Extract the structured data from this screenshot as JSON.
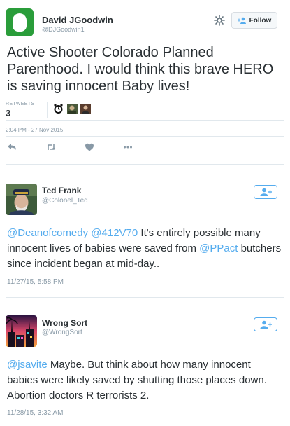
{
  "main_tweet": {
    "name": "David JGoodwin",
    "handle": "@DJGoodwin1",
    "follow_label": "Follow",
    "text": "Active Shooter Colorado Planned Parenthood.  I would think this brave HERO is saving innocent Baby lives!",
    "retweets_label": "RETWEETS",
    "retweets_count": "3",
    "timestamp": "2:04 PM - 27 Nov 2015"
  },
  "replies": [
    {
      "name": "Ted Frank",
      "handle": "@Colonel_Ted",
      "mentions": [
        "@Deanofcomedy",
        "@412V70",
        "@PPact"
      ],
      "text_a": "It's entirely possible many innocent lives of babies were saved from",
      "text_b": "butchers since incident began at mid-day..",
      "timestamp": "11/27/15, 5:58 PM"
    },
    {
      "name": "Wrong Sort",
      "handle": "@WrongSort",
      "mentions": [
        "@jsavite"
      ],
      "text_a": "Maybe.  But think about how many innocent babies were likely saved by shutting those places down.  Abortion doctors R terrorists 2.",
      "timestamp": "11/28/15, 3:32 AM"
    }
  ],
  "colors": {
    "link": "#55acee",
    "text": "#292f33",
    "muted": "#8899a6",
    "avatar_green": "#2a9d3a"
  },
  "icons": {
    "settings": "gear-icon",
    "follow": "add-person-icon",
    "reply": "reply-icon",
    "retweet": "retweet-icon",
    "like": "heart-icon",
    "more": "more-icon"
  }
}
